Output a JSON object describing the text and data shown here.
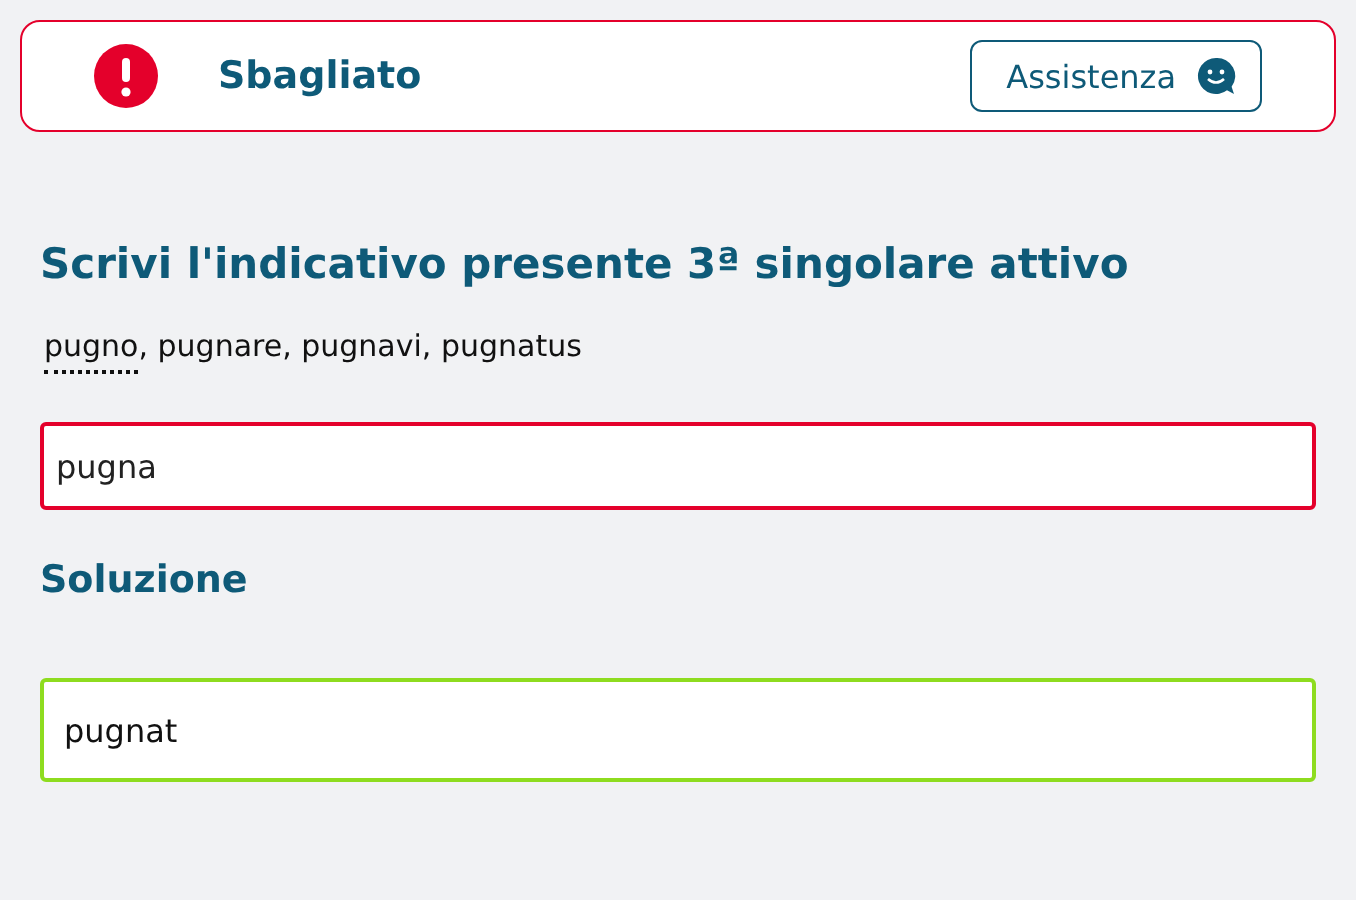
{
  "banner": {
    "correct": false,
    "title": "Sbagliato",
    "help_button": "Assistenza"
  },
  "question": {
    "heading": "Scrivi l'indicativo presente 3ª singolare attivo",
    "principal_parts": [
      {
        "text": "pugno",
        "dotted": true
      },
      {
        "text": ", pugnare, pugnavi, pugnatus",
        "dotted": false
      }
    ]
  },
  "answer_field": {
    "value": "pugna",
    "correct": false
  },
  "solution": {
    "heading": "Soluzione",
    "value": "pugnat",
    "correct": true
  }
}
